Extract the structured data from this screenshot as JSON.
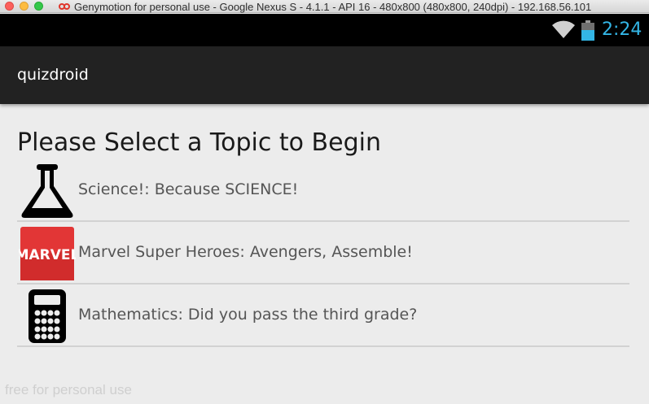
{
  "window": {
    "title": "Genymotion for personal use - Google Nexus S - 4.1.1 - API 16 - 480x800 (480x800, 240dpi) - 192.168.56.101"
  },
  "statusbar": {
    "time": "2:24",
    "accent_color": "#33b5e5",
    "icons": [
      "wifi-icon",
      "battery-icon"
    ]
  },
  "actionbar": {
    "app_title": "quizdroid"
  },
  "main": {
    "heading": "Please Select a Topic to Begin",
    "topics": [
      {
        "icon": "flask-icon",
        "label": "Science!: Because SCIENCE!"
      },
      {
        "icon": "marvel-logo-icon",
        "label": "Marvel Super Heroes: Avengers, Assemble!",
        "icon_text": "MARVEL"
      },
      {
        "icon": "calculator-icon",
        "label": "Mathematics: Did you pass the third grade?"
      }
    ]
  },
  "watermark": "free for personal use"
}
